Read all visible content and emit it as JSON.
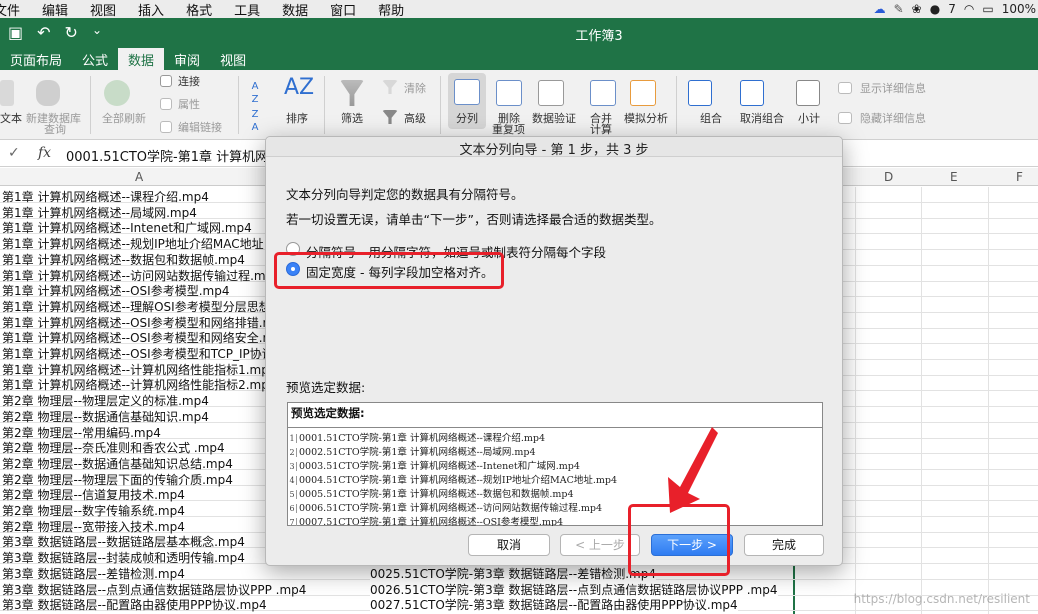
{
  "menubar": {
    "items": [
      "文件",
      "编辑",
      "视图",
      "插入",
      "格式",
      "工具",
      "数据",
      "窗口",
      "帮助"
    ],
    "status": {
      "count": "7",
      "battery": "100%"
    }
  },
  "window": {
    "title": "工作簿3"
  },
  "tabs": [
    {
      "label": "页面布局"
    },
    {
      "label": "公式"
    },
    {
      "label": "数据",
      "active": true
    },
    {
      "label": "审阅"
    },
    {
      "label": "视图"
    }
  ],
  "ribbon": {
    "text_btn": "文本",
    "new_query": "新建数据库",
    "new_query2": "查询",
    "refresh_all": "全部刷新",
    "connections": "连接",
    "properties": "属性",
    "edit_links": "编辑链接",
    "sort": "排序",
    "filter": "筛选",
    "clear": "清除",
    "advanced": "高级",
    "split": "分列",
    "remove_dup": "删除",
    "remove_dup2": "重复项",
    "validation": "数据验证",
    "consolidate": "合并",
    "consolidate2": "计算",
    "whatif": "模拟分析",
    "group": "组合",
    "ungroup": "取消组合",
    "subtotal": "小计",
    "show_detail": "显示详细信息",
    "hide_detail": "隐藏详细信息",
    "sort_az": "A Z",
    "sort_za": "Z A",
    "sort_big": "AZ"
  },
  "formula_bar": {
    "value": "0001.51CTO学院-第1章 计算机网"
  },
  "columns": [
    "A",
    "D",
    "E",
    "F"
  ],
  "rows_a": [
    "第1章 计算机网络概述--课程介绍.mp4",
    "第1章 计算机网络概述--局域网.mp4",
    "第1章 计算机网络概述--Intenet和广域网.mp4",
    "第1章 计算机网络概述--规划IP地址介绍MAC地址",
    "第1章 计算机网络概述--数据包和数据帧.mp4",
    "第1章 计算机网络概述--访问网站数据传输过程.mp",
    "第1章 计算机网络概述--OSI参考模型.mp4",
    "第1章 计算机网络概述--理解OSI参考模型分层思想",
    "第1章 计算机网络概述--OSI参考模型和网络排错.m",
    "第1章 计算机网络概述--OSI参考模型和网络安全.m",
    "第1章 计算机网络概述--OSI参考模型和TCP_IP协议",
    "第1章 计算机网络概述--计算机网络性能指标1.mp",
    "第1章 计算机网络概述--计算机网络性能指标2.mp4",
    "第2章 物理层--物理层定义的标准.mp4",
    "第2章 物理层--数据通信基础知识.mp4",
    "第2章 物理层--常用编码.mp4",
    "第2章 物理层--奈氏准则和香农公式 .mp4",
    "第2章 物理层--数据通信基础知识总结.mp4",
    "第2章 物理层--物理层下面的传输介质.mp4",
    "第2章 物理层--信道复用技术.mp4",
    "第2章 物理层--数字传输系统.mp4",
    "第2章 物理层--宽带接入技术.mp4",
    "第3章 数据链路层--数据链路层基本概念.mp4",
    "第3章 数据链路层--封装成帧和透明传输.mp4",
    "第3章 数据链路层--差错检测.mp4",
    "第3章 数据链路层--点到点通信数据链路层协议PPP .mp4",
    "第3章 数据链路层--配置路由器使用PPP协议.mp4"
  ],
  "rows_b": [
    "0025.51CTO学院-第3章 数据链路层--差错检测.mp4",
    "0026.51CTO学院-第3章 数据链路层--点到点通信数据链路层协议PPP .mp4",
    "0027.51CTO学院-第3章 数据链路层--配置路由器使用PPP协议.mp4"
  ],
  "dialog": {
    "title": "文本分列向导 - 第 1 步，共 3 步",
    "line1": "文本分列向导判定您的数据具有分隔符号。",
    "line2": "若一切设置无误，请单击“下一步”，否则请选择最合适的数据类型。",
    "opt_delimited": "分隔符号 - 用分隔字符，如逗号或制表符分隔每个字段",
    "opt_fixed": "固定宽度 - 每列字段加空格对齐。",
    "preview_label": "预览选定数据:",
    "preview_header": "预览选定数据:",
    "preview_lines": [
      {
        "n": "1",
        "t": "0001.51CTO学院-第1章 计算机网络概述--课程介绍.mp4"
      },
      {
        "n": "2",
        "t": "0002.51CTO学院-第1章 计算机网络概述--局域网.mp4"
      },
      {
        "n": "3",
        "t": "0003.51CTO学院-第1章 计算机网络概述--Intenet和广域网.mp4"
      },
      {
        "n": "4",
        "t": "0004.51CTO学院-第1章 计算机网络概述--规划IP地址介绍MAC地址.mp4"
      },
      {
        "n": "5",
        "t": "0005.51CTO学院-第1章 计算机网络概述--数据包和数据帧.mp4"
      },
      {
        "n": "6",
        "t": "0006.51CTO学院-第1章 计算机网络概述--访问网站数据传输过程.mp4"
      },
      {
        "n": "7",
        "t": "0007.51CTO学院-第1章 计算机网络概述--OSI参考模型.mp4"
      }
    ],
    "cancel": "取消",
    "back": "< 上一步",
    "next": "下一步 >",
    "finish": "完成"
  },
  "watermark": "https://blog.csdn.net/resilient",
  "colors": {
    "excel_green": "#1f7346",
    "highlight_red": "#e8202a",
    "primary_blue": "#2f7cf2"
  }
}
